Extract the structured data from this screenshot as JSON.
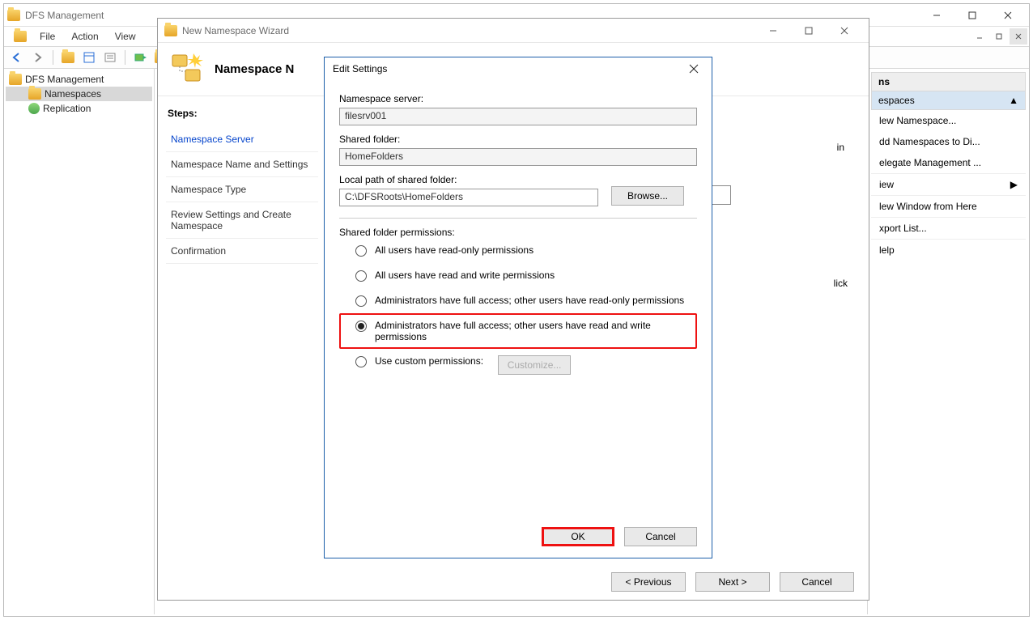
{
  "outer": {
    "title": "DFS Management",
    "menu": {
      "file": "File",
      "action": "Action",
      "view": "View"
    },
    "tree": {
      "root": "DFS Management",
      "namespaces": "Namespaces",
      "replication": "Replication"
    },
    "actions_panel": {
      "header_suffix": "ns",
      "sub": "espaces",
      "items": [
        "lew Namespace...",
        "dd Namespaces to Di...",
        "elegate Management ...",
        "iew",
        "lew Window from Here",
        "xport List...",
        "lelp"
      ]
    }
  },
  "wizard": {
    "title": "New Namespace Wizard",
    "header": "Namespace N",
    "steps_label": "Steps:",
    "steps": [
      "Namespace Server",
      "Namespace Name and Settings",
      "Namespace Type",
      "Review Settings and Create Namespace",
      "Confirmation"
    ],
    "field_hint_suffix_in": "in",
    "field_hint_suffix_lick": "lick",
    "footer": {
      "prev": "< Previous",
      "next": "Next >",
      "cancel": "Cancel"
    }
  },
  "dialog": {
    "title": "Edit Settings",
    "labels": {
      "ns_server": "Namespace server:",
      "shared": "Shared folder:",
      "local_path": "Local path of shared folder:",
      "perm_heading": "Shared folder permissions:"
    },
    "values": {
      "ns_server": "filesrv001",
      "shared": "HomeFolders",
      "local_path": "C:\\DFSRoots\\HomeFolders"
    },
    "buttons": {
      "browse": "Browse...",
      "customize": "Customize...",
      "ok": "OK",
      "cancel": "Cancel"
    },
    "perms": [
      "All users have read-only permissions",
      "All users have read and write permissions",
      "Administrators have full access; other users have read-only permissions",
      "Administrators have full access; other users have read and write permissions",
      "Use custom permissions:"
    ],
    "selected_perm_index": 3
  }
}
